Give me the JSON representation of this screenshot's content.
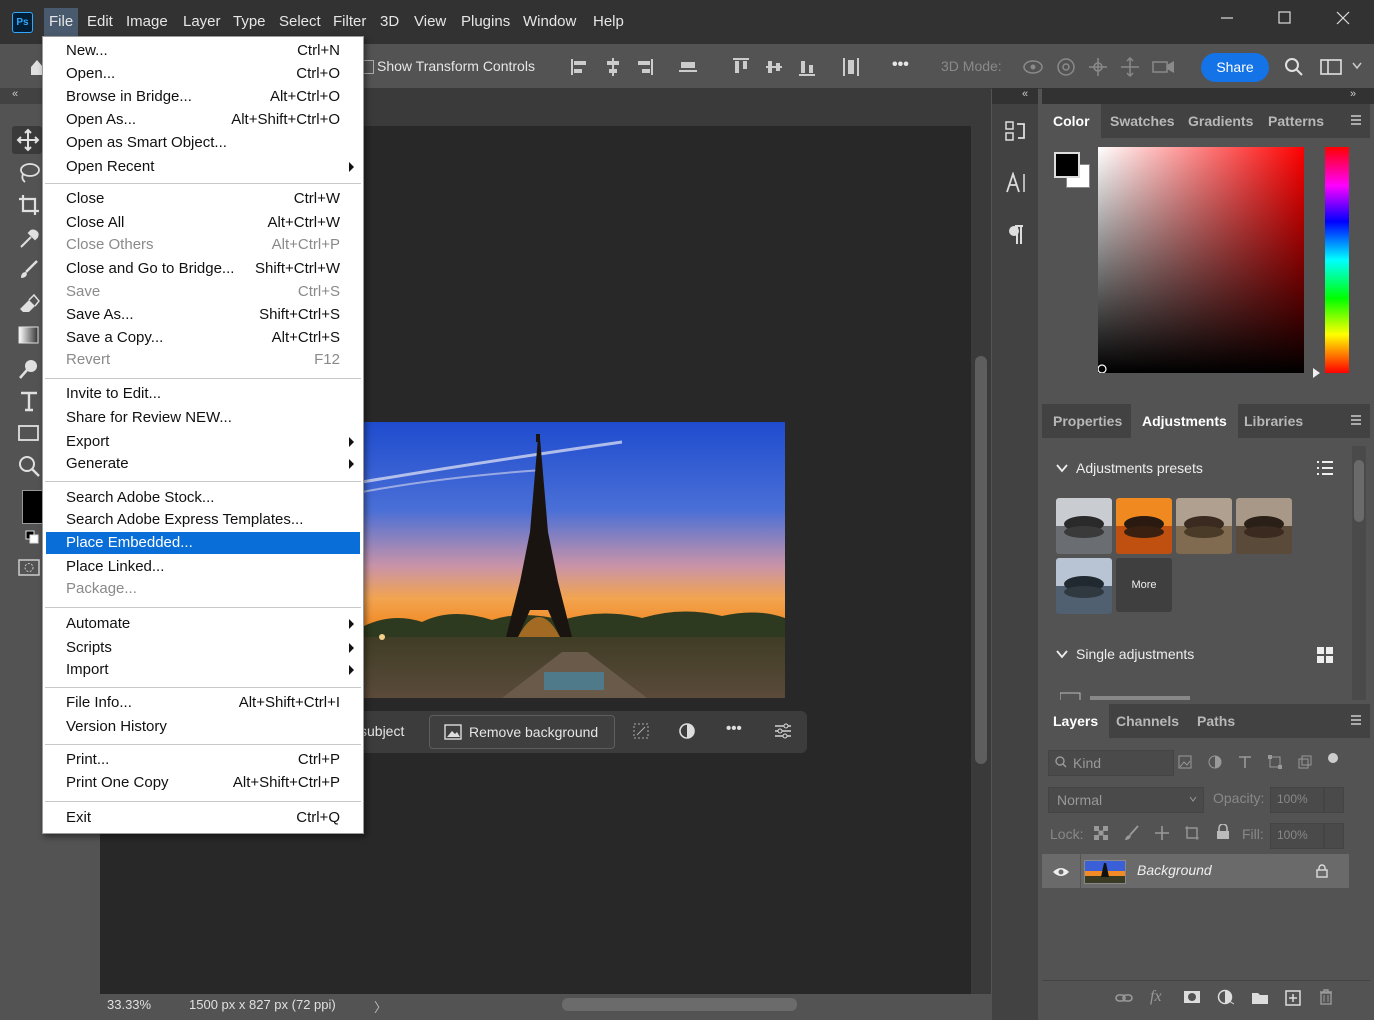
{
  "app": {
    "logo": "Ps"
  },
  "menubar": {
    "items": [
      "File",
      "Edit",
      "Image",
      "Layer",
      "Type",
      "Select",
      "Filter",
      "3D",
      "View",
      "Plugins",
      "Window",
      "Help"
    ]
  },
  "options_bar": {
    "show_transform_label": "Show Transform Controls",
    "mode_3d_label": "3D Mode:",
    "share_label": "Share",
    "more_label": "•••"
  },
  "file_menu": {
    "groups": [
      [
        {
          "label": "New...",
          "shortcut": "Ctrl+N"
        },
        {
          "label": "Open...",
          "shortcut": "Ctrl+O"
        },
        {
          "label": "Browse in Bridge...",
          "shortcut": "Alt+Ctrl+O"
        },
        {
          "label": "Open As...",
          "shortcut": "Alt+Shift+Ctrl+O"
        },
        {
          "label": "Open as Smart Object...",
          "shortcut": ""
        },
        {
          "label": "Open Recent",
          "shortcut": "",
          "submenu": true
        }
      ],
      [
        {
          "label": "Close",
          "shortcut": "Ctrl+W"
        },
        {
          "label": "Close All",
          "shortcut": "Alt+Ctrl+W"
        },
        {
          "label": "Close Others",
          "shortcut": "Alt+Ctrl+P",
          "disabled": true
        },
        {
          "label": "Close and Go to Bridge...",
          "shortcut": "Shift+Ctrl+W"
        },
        {
          "label": "Save",
          "shortcut": "Ctrl+S",
          "disabled": true
        },
        {
          "label": "Save As...",
          "shortcut": "Shift+Ctrl+S"
        },
        {
          "label": "Save a Copy...",
          "shortcut": "Alt+Ctrl+S"
        },
        {
          "label": "Revert",
          "shortcut": "F12",
          "disabled": true
        }
      ],
      [
        {
          "label": "Invite to Edit...",
          "shortcut": ""
        },
        {
          "label": "Share for Review NEW...",
          "shortcut": ""
        },
        {
          "label": "Export",
          "shortcut": "",
          "submenu": true
        },
        {
          "label": "Generate",
          "shortcut": "",
          "submenu": true
        }
      ],
      [
        {
          "label": "Search Adobe Stock...",
          "shortcut": ""
        },
        {
          "label": "Search Adobe Express Templates...",
          "shortcut": ""
        },
        {
          "label": "Place Embedded...",
          "shortcut": "",
          "highlighted": true
        },
        {
          "label": "Place Linked...",
          "shortcut": ""
        },
        {
          "label": "Package...",
          "shortcut": "",
          "disabled": true
        }
      ],
      [
        {
          "label": "Automate",
          "shortcut": "",
          "submenu": true
        },
        {
          "label": "Scripts",
          "shortcut": "",
          "submenu": true
        },
        {
          "label": "Import",
          "shortcut": "",
          "submenu": true
        }
      ],
      [
        {
          "label": "File Info...",
          "shortcut": "Alt+Shift+Ctrl+I"
        },
        {
          "label": "Version History",
          "shortcut": ""
        }
      ],
      [
        {
          "label": "Print...",
          "shortcut": "Ctrl+P"
        },
        {
          "label": "Print One Copy",
          "shortcut": "Alt+Shift+Ctrl+P"
        }
      ],
      [
        {
          "label": "Exit",
          "shortcut": "Ctrl+Q"
        }
      ]
    ]
  },
  "contextual_bar": {
    "select_subject_label": "subject",
    "remove_background_label": "Remove background",
    "more_label": "•••"
  },
  "status_bar": {
    "zoom": "33.33%",
    "doc_info": "1500 px x 827 px (72 ppi)",
    "arrow": "〉"
  },
  "color_panel": {
    "tabs": [
      "Color",
      "Swatches",
      "Gradients",
      "Patterns"
    ],
    "active_tab": "Color",
    "foreground": "#000000",
    "background": "#ffffff",
    "hue_color": "#ff0000"
  },
  "adjustments_panel": {
    "tabs": [
      "Properties",
      "Adjustments",
      "Libraries"
    ],
    "active_tab": "Adjustments",
    "presets_label": "Adjustments presets",
    "more_label": "More",
    "single_label": "Single adjustments"
  },
  "layers_panel": {
    "tabs": [
      "Layers",
      "Channels",
      "Paths"
    ],
    "active_tab": "Layers",
    "kind_label": "Kind",
    "blend_mode": "Normal",
    "opacity_label": "Opacity:",
    "opacity_value": "100%",
    "lock_label": "Lock:",
    "fill_label": "Fill:",
    "fill_value": "100%",
    "layers": [
      {
        "name": "Background",
        "visible": true,
        "locked": true
      }
    ],
    "footer_fx": "fx"
  },
  "colors": {
    "accent": "#1473e6",
    "menu_highlight": "#0a6ed8",
    "panel_bg": "#535353",
    "doc_bg": "#282828"
  }
}
